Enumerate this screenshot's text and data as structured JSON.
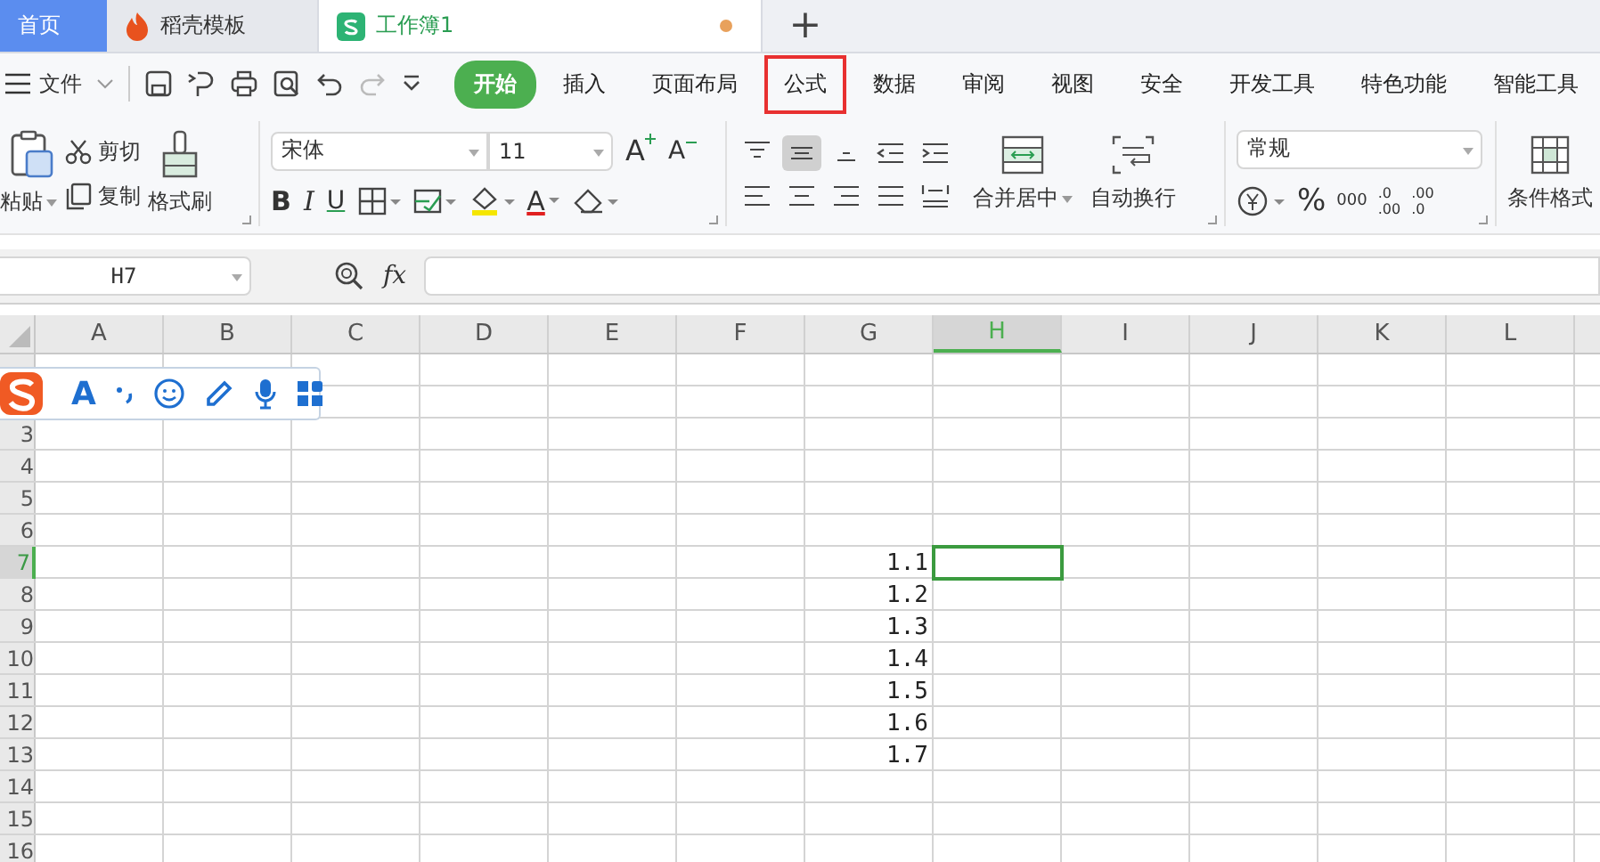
{
  "tabs": [
    {
      "label": "首页",
      "kind": "home",
      "selected": false
    },
    {
      "label": "稻壳模板",
      "kind": "docer",
      "selected": false
    },
    {
      "label": "工作簿1",
      "kind": "sheet",
      "selected": true,
      "modified": true
    }
  ],
  "new_tab": "+",
  "file_menu": "文件",
  "ribbon_tabs": [
    {
      "label": "开始",
      "selected": true,
      "highlighted": false
    },
    {
      "label": "插入",
      "selected": false,
      "highlighted": false
    },
    {
      "label": "页面布局",
      "selected": false,
      "highlighted": false
    },
    {
      "label": "公式",
      "selected": false,
      "highlighted": true
    },
    {
      "label": "数据",
      "selected": false,
      "highlighted": false
    },
    {
      "label": "审阅",
      "selected": false,
      "highlighted": false
    },
    {
      "label": "视图",
      "selected": false,
      "highlighted": false
    },
    {
      "label": "安全",
      "selected": false,
      "highlighted": false
    },
    {
      "label": "开发工具",
      "selected": false,
      "highlighted": false
    },
    {
      "label": "特色功能",
      "selected": false,
      "highlighted": false
    },
    {
      "label": "智能工具",
      "selected": false,
      "highlighted": false
    }
  ],
  "clipboard": {
    "paste": "粘贴",
    "cut": "剪切",
    "copy": "复制",
    "format_painter": "格式刷"
  },
  "font": {
    "name": "宋体",
    "size": "11",
    "grow": "A",
    "shrink": "A",
    "bold": "B",
    "italic": "I",
    "underline": "U",
    "font_color": "A"
  },
  "alignment": {
    "merge": "合并居中",
    "wrap": "自动换行",
    "center_selected": true
  },
  "number": {
    "format": "常规",
    "percent": "%",
    "thousands": "000",
    "increase": [
      ".0",
      ".00"
    ],
    "decrease": [
      ".00",
      ".0"
    ]
  },
  "conditional_format": "条件格式",
  "formula_bar": {
    "name_box": "H7",
    "fx": "fx"
  },
  "sheet": {
    "columns": [
      {
        "label": "A",
        "selected": false
      },
      {
        "label": "B",
        "selected": false
      },
      {
        "label": "C",
        "selected": false
      },
      {
        "label": "D",
        "selected": false
      },
      {
        "label": "E",
        "selected": false
      },
      {
        "label": "F",
        "selected": false
      },
      {
        "label": "G",
        "selected": false
      },
      {
        "label": "H",
        "selected": true
      },
      {
        "label": "I",
        "selected": false
      },
      {
        "label": "J",
        "selected": false
      },
      {
        "label": "K",
        "selected": false
      },
      {
        "label": "L",
        "selected": false
      }
    ],
    "rows": [
      {
        "selected": false,
        "cells": {}
      },
      {
        "selected": false,
        "cells": {}
      },
      {
        "header": "3",
        "selected": false,
        "cells": {}
      },
      {
        "header": "4",
        "selected": false,
        "cells": {}
      },
      {
        "header": "5",
        "selected": false,
        "cells": {}
      },
      {
        "header": "6",
        "selected": false,
        "cells": {}
      },
      {
        "header": "7",
        "selected": true,
        "cells": {
          "G": "1.1"
        }
      },
      {
        "header": "8",
        "selected": false,
        "cells": {
          "G": "1.2"
        }
      },
      {
        "header": "9",
        "selected": false,
        "cells": {
          "G": "1.3"
        }
      },
      {
        "header": "10",
        "selected": false,
        "cells": {
          "G": "1.4"
        }
      },
      {
        "header": "11",
        "selected": false,
        "cells": {
          "G": "1.5"
        }
      },
      {
        "header": "12",
        "selected": false,
        "cells": {
          "G": "1.6"
        }
      },
      {
        "header": "13",
        "selected": false,
        "cells": {
          "G": "1.7"
        }
      },
      {
        "header": "14",
        "selected": false,
        "cells": {}
      },
      {
        "header": "15",
        "selected": false,
        "cells": {}
      },
      {
        "header": "16",
        "selected": false,
        "cells": {}
      }
    ]
  },
  "ime_toolbar": {
    "font_key": "A"
  }
}
